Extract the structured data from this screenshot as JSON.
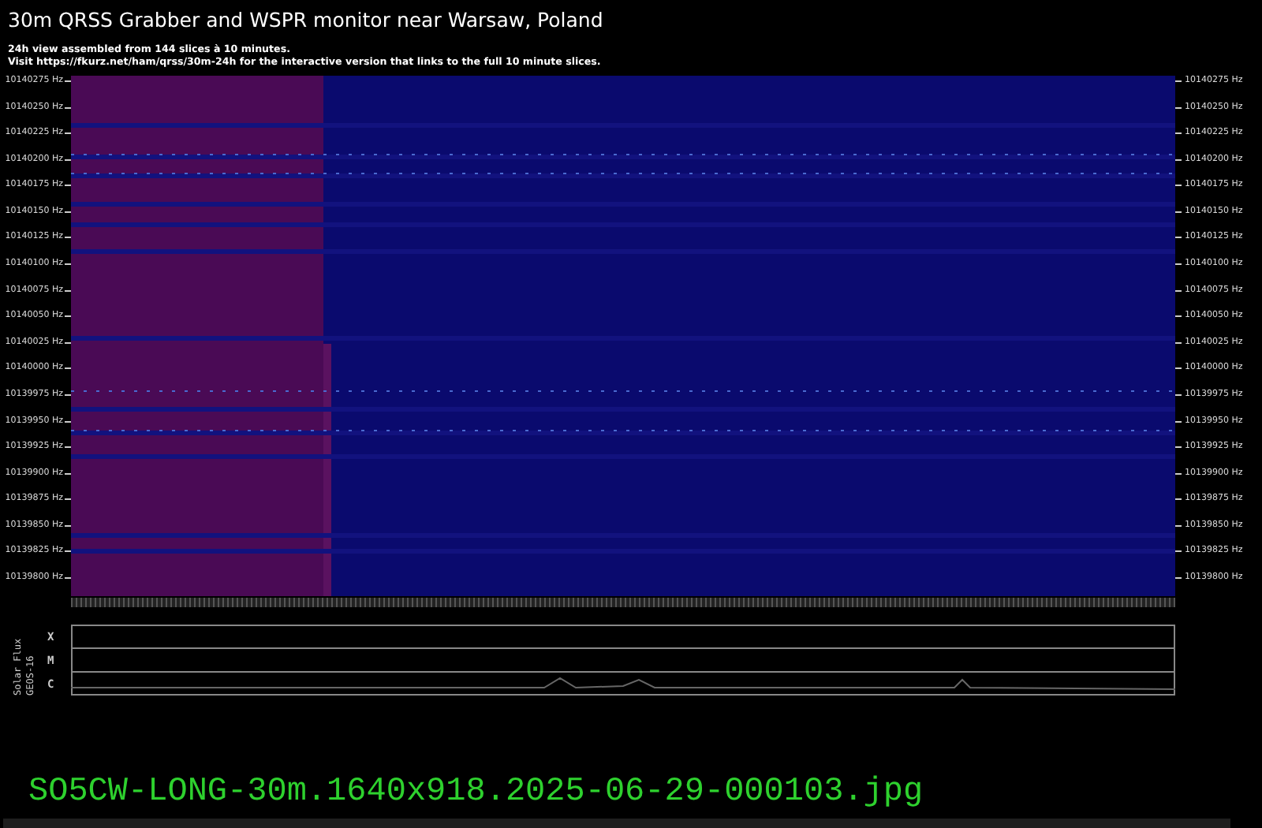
{
  "title": "30m QRSS Grabber and WSPR monitor near Warsaw, Poland",
  "description": [
    "24h view assembled from 144 slices à 10 minutes.",
    "Visit https://fkurz.net/ham/qrss/30m-24h for the interactive version that links to the full 10 minute slices."
  ],
  "frequency_axis_left": [
    "10140275 Hz",
    "10140250 Hz",
    "10140225 Hz",
    "10140200 Hz",
    "10140175 Hz",
    "10140150 Hz",
    "10140125 Hz",
    "10140100 Hz",
    "10140075 Hz",
    "10140050 Hz",
    "10140025 Hz",
    "10140000 Hz",
    "10139975 Hz",
    "10139950 Hz",
    "10139925 Hz",
    "10139900 Hz",
    "10139875 Hz",
    "10139850 Hz",
    "10139825 Hz",
    "10139800 Hz"
  ],
  "frequency_axis_right": [
    "10140275 Hz",
    "10140250 Hz",
    "10140225 Hz",
    "10140200 Hz",
    "10140175 Hz",
    "10140150 Hz",
    "10140125 Hz",
    "10140100 Hz",
    "10140075 Hz",
    "10140050 Hz",
    "10140025 Hz",
    "10140000 Hz",
    "10139975 Hz",
    "10139950 Hz",
    "10139925 Hz",
    "10139900 Hz",
    "10139875 Hz",
    "10139850 Hz",
    "10139825 Hz",
    "10139800 Hz"
  ],
  "solar_flux": {
    "label": "Solar Flux",
    "source": "GEOS-16",
    "rows": [
      "X",
      "M",
      "C"
    ]
  },
  "filename": "SO5CW-LONG-30m.1640x918.2025-06-29-000103.jpg"
}
